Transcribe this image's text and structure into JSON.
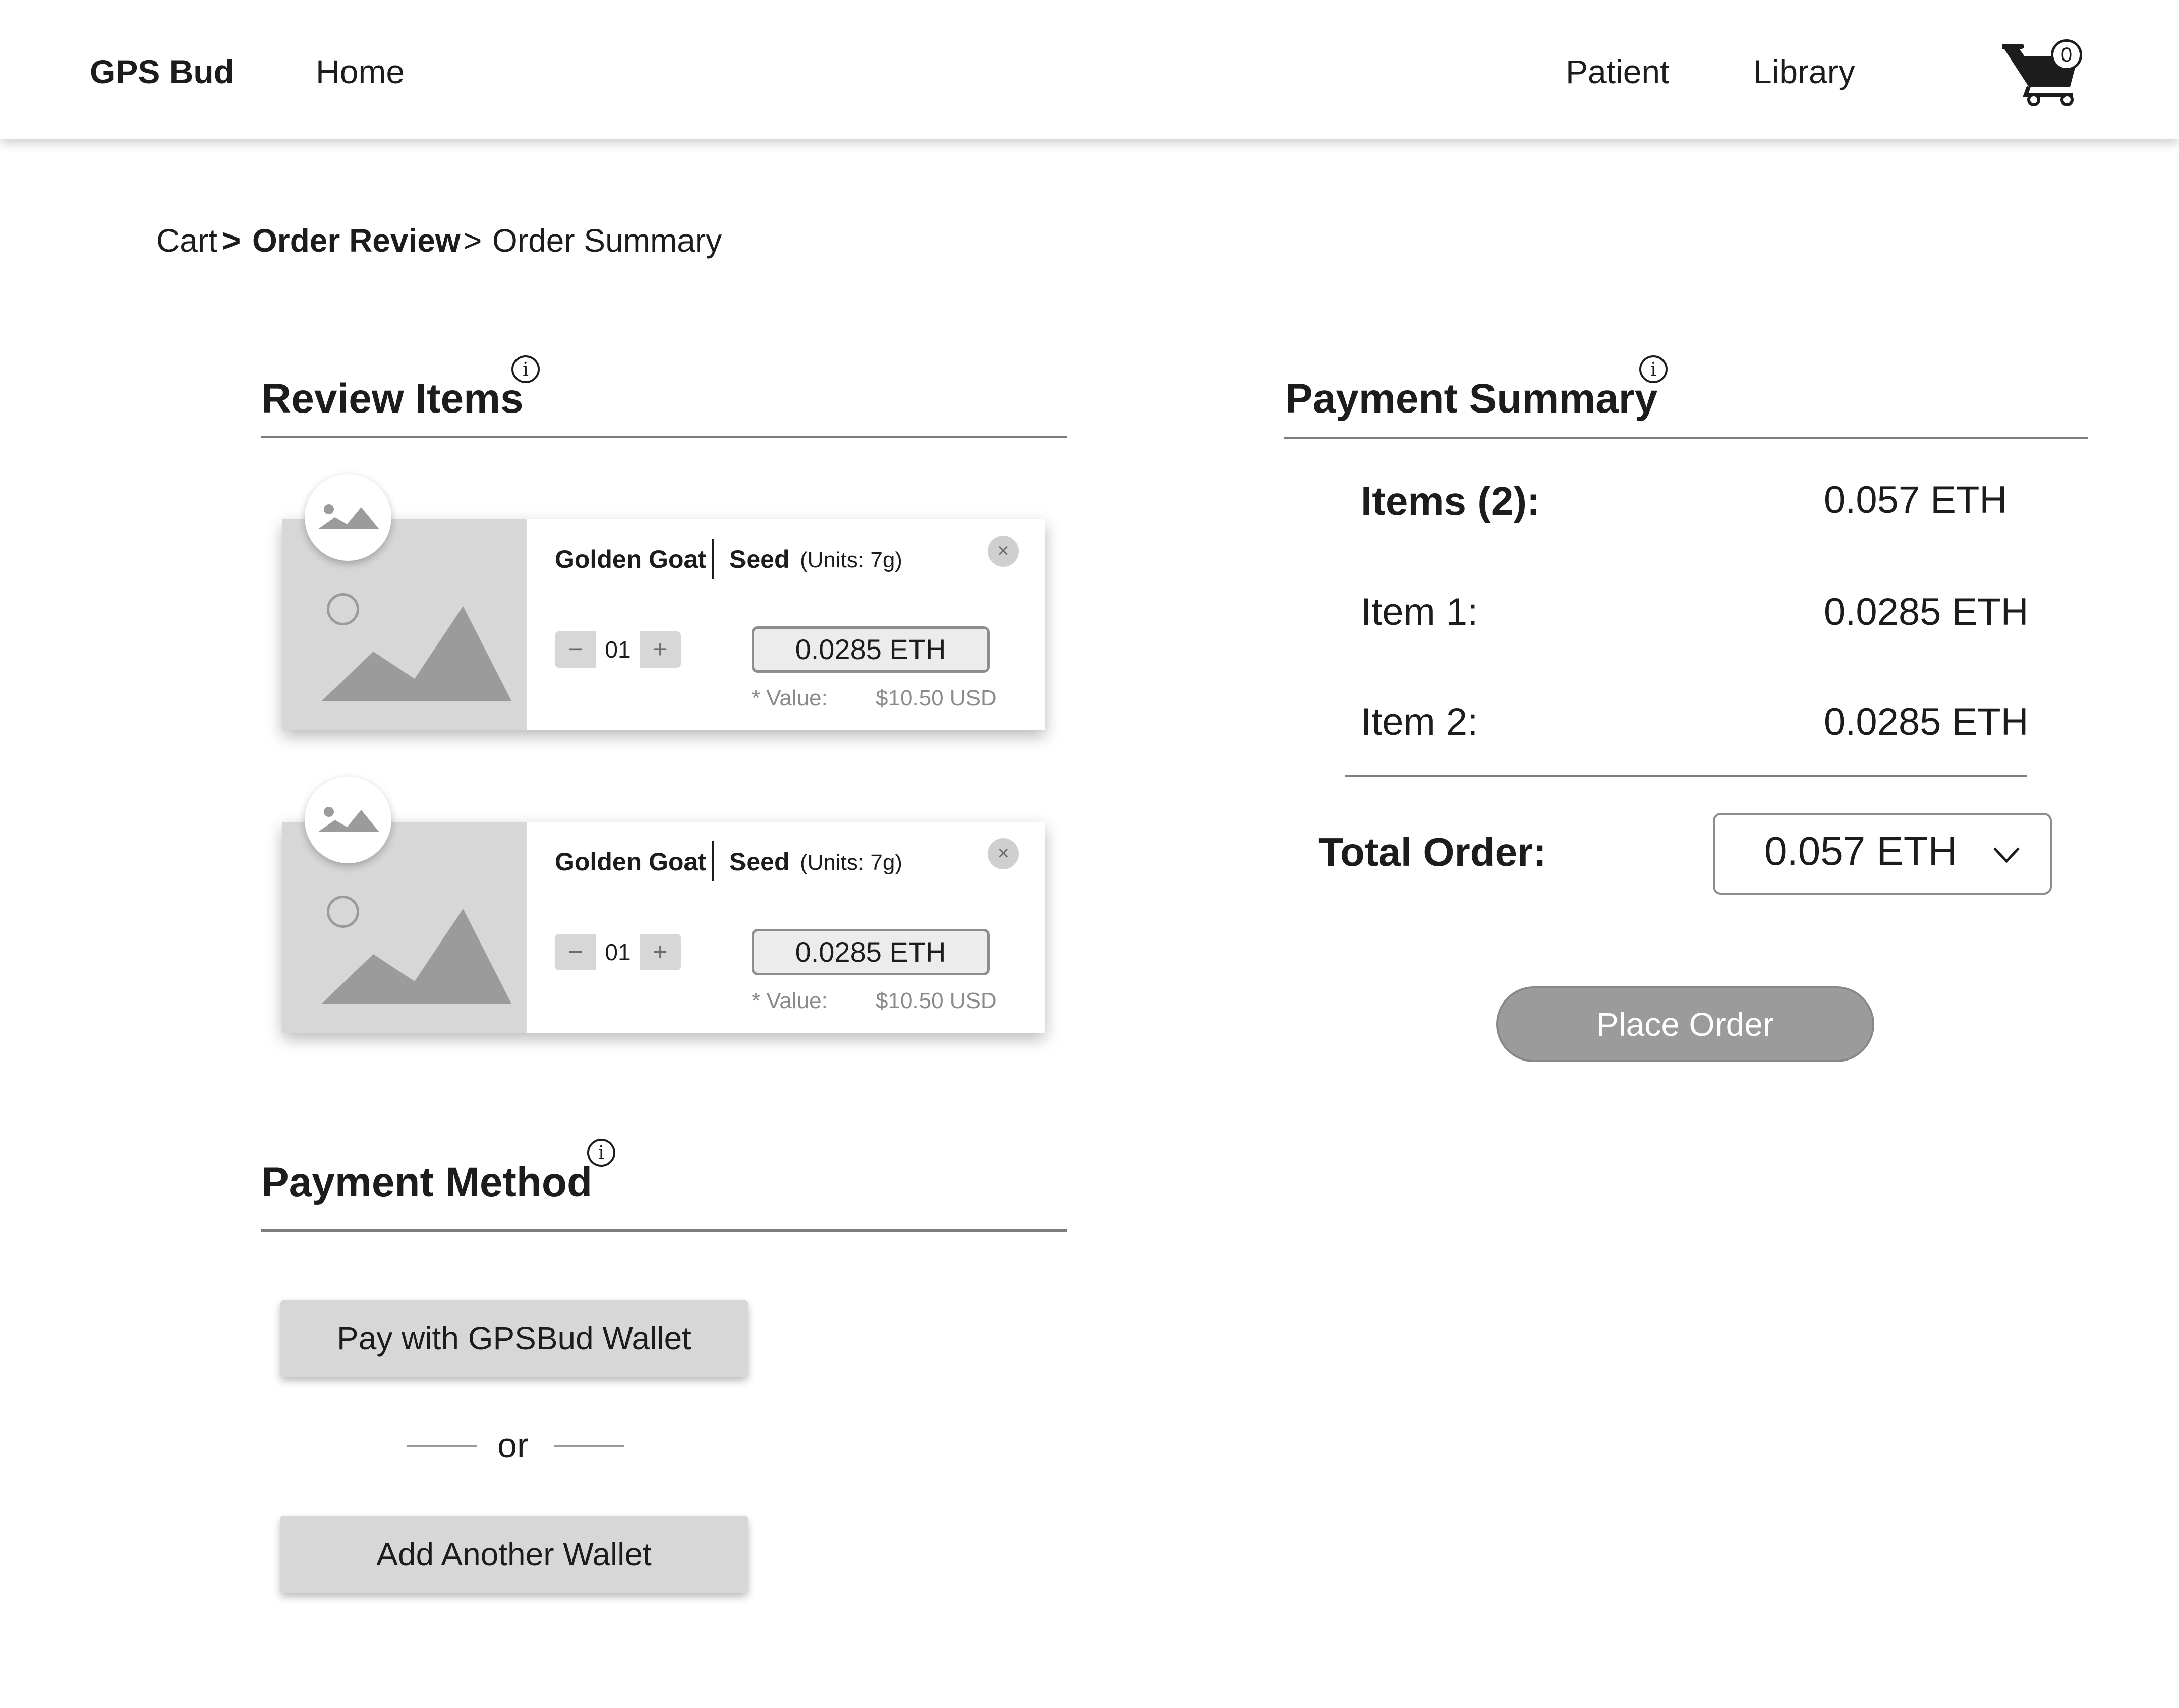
{
  "header": {
    "brand": "GPS Bud",
    "nav": {
      "home": "Home",
      "patient": "Patient",
      "library": "Library"
    },
    "cart_count": "0",
    "cart_icon": "shopping-cart-icon"
  },
  "breadcrumb": {
    "cart": "Cart",
    "sep1": ">",
    "order_review": "Order Review",
    "sep2": ">",
    "order_summary": "Order Summary"
  },
  "review_items": {
    "title": "Review Items",
    "info_glyph": "i",
    "items": [
      {
        "name": "Golden Goat",
        "type": "Seed",
        "units": "(Units: 7g)",
        "quantity": "01",
        "minus": "−",
        "plus": "+",
        "price": "0.0285 ETH",
        "value_label": "* Value:",
        "value_usd": "$10.50 USD",
        "remove": "×"
      },
      {
        "name": "Golden Goat",
        "type": "Seed",
        "units": "(Units: 7g)",
        "quantity": "01",
        "minus": "−",
        "plus": "+",
        "price": "0.0285 ETH",
        "value_label": "* Value:",
        "value_usd": "$10.50 USD",
        "remove": "×"
      }
    ]
  },
  "payment_method": {
    "title": "Payment Method",
    "info_glyph": "i",
    "primary_button": "Pay with GPSBud Wallet",
    "divider_text": "or",
    "secondary_button": "Add Another Wallet"
  },
  "payment_summary": {
    "title": "Payment Summary",
    "info_glyph": "i",
    "items_label": "Items (2):",
    "items_value": "0.057 ETH",
    "lines": [
      {
        "label": "Item 1:",
        "value": "0.0285 ETH"
      },
      {
        "label": "Item 2:",
        "value": "0.0285 ETH"
      }
    ],
    "total_label": "Total Order:",
    "total_value": "0.057 ETH",
    "place_order": "Place Order"
  },
  "colors": {
    "text": "#1c1c1c",
    "placeholder_gray": "#d7d7d7",
    "button_gray": "#9b9b9b",
    "muted_text": "#8a8a8a"
  }
}
